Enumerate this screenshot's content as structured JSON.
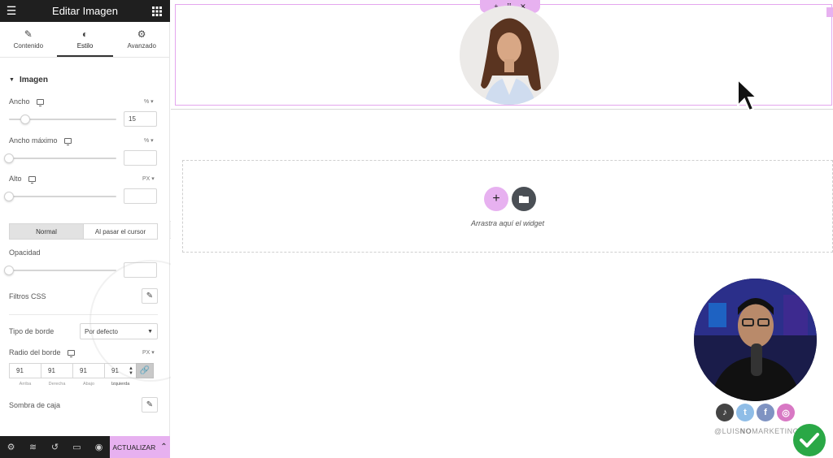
{
  "panel": {
    "title": "Editar Imagen",
    "tabs": [
      {
        "label": "Contenido",
        "icon": "pencil-icon"
      },
      {
        "label": "Estilo",
        "icon": "contrast-icon"
      },
      {
        "label": "Avanzado",
        "icon": "gear-icon"
      }
    ],
    "section_title": "Imagen",
    "width": {
      "label": "Ancho",
      "unit": "%",
      "value": "15",
      "slider_fraction": 0.15
    },
    "max_width": {
      "label": "Ancho máximo",
      "unit": "%",
      "value": ""
    },
    "height": {
      "label": "Alto",
      "unit": "PX",
      "value": ""
    },
    "state_tabs": [
      "Normal",
      "Al pasar el cursor"
    ],
    "opacity": {
      "label": "Opacidad",
      "value": ""
    },
    "css_filters": {
      "label": "Filtros CSS"
    },
    "border_type": {
      "label": "Tipo de borde",
      "selected": "Por defecto"
    },
    "border_radius": {
      "label": "Radio del borde",
      "unit": "PX",
      "values": [
        "91",
        "91",
        "91",
        "91"
      ],
      "labels": [
        "Arriba",
        "Derecha",
        "Abajo",
        "Izquierda"
      ]
    },
    "box_shadow": {
      "label": "Sombra de caja"
    },
    "update_label": "ACTUALIZAR"
  },
  "canvas": {
    "drop_text": "Arrastra aquí el widget"
  },
  "overlay": {
    "handle_pre": "@LUIS",
    "handle_bold": "NO",
    "handle_post": "MARKETING",
    "socials": [
      "tiktok-icon",
      "twitter-icon",
      "facebook-icon",
      "instagram-icon"
    ]
  },
  "colors": {
    "accent": "#e7b1f0",
    "dark": "#1f1f1f",
    "check": "#2aa846"
  }
}
